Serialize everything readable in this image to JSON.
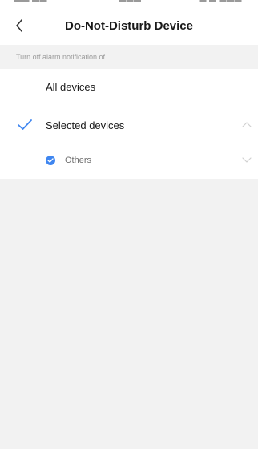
{
  "status_bar": {
    "left": "▬▬ ▬▬ ━",
    "center": "▬▬▬",
    "right": "▬ ▬ ▬▬▬"
  },
  "nav": {
    "title": "Do-Not-Disturb Device",
    "back_icon": "chevron-left-icon"
  },
  "section": {
    "header": "Turn off alarm notification of"
  },
  "options": [
    {
      "label": "All devices",
      "selected": false
    },
    {
      "label": "Selected devices",
      "selected": true,
      "expanded": true
    }
  ],
  "sub_items": [
    {
      "label": "Others",
      "checked": true,
      "expanded": false
    }
  ],
  "colors": {
    "accent": "#3f86f0",
    "background": "#f2f2f2",
    "surface": "#ffffff",
    "text_primary": "#1a1a1a",
    "text_secondary": "#9a9a9a"
  }
}
